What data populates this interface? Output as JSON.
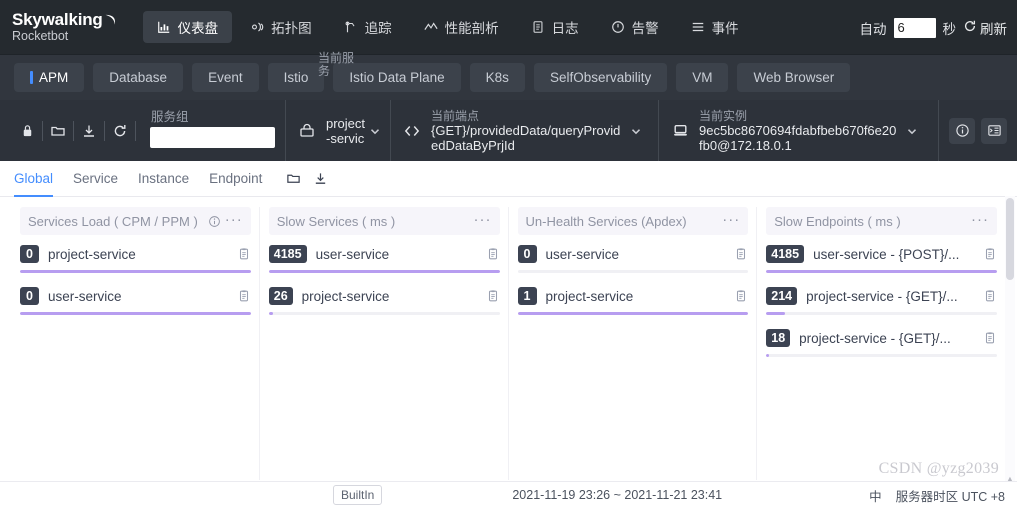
{
  "brand": {
    "name": "Skywalking",
    "sub": "Rocketbot"
  },
  "topnav": {
    "items": [
      {
        "label": "仪表盘",
        "icon": "dashboard-icon",
        "active": true
      },
      {
        "label": "拓扑图",
        "icon": "topology-icon",
        "active": false
      },
      {
        "label": "追踪",
        "icon": "trace-icon",
        "active": false
      },
      {
        "label": "性能剖析",
        "icon": "profile-icon",
        "active": false
      },
      {
        "label": "日志",
        "icon": "log-icon",
        "active": false
      },
      {
        "label": "告警",
        "icon": "alarm-icon",
        "active": false
      },
      {
        "label": "事件",
        "icon": "event-icon",
        "active": false
      }
    ],
    "auto_label": "自动",
    "auto_value": "6",
    "seconds_label": "秒",
    "refresh_label": "刷新"
  },
  "tabs": [
    {
      "label": "APM",
      "active": true
    },
    {
      "label": "Database",
      "active": false
    },
    {
      "label": "Event",
      "active": false
    },
    {
      "label": "Istio",
      "active": false
    },
    {
      "label": "Istio Data Plane",
      "active": false
    },
    {
      "label": "K8s",
      "active": false
    },
    {
      "label": "SelfObservability",
      "active": false
    },
    {
      "label": "VM",
      "active": false
    },
    {
      "label": "Web Browser",
      "active": false
    }
  ],
  "selector": {
    "icons": [
      "lock-icon",
      "folder-icon",
      "download-icon",
      "refresh-icon"
    ],
    "group_label": "服务组",
    "group_value": "",
    "service": {
      "label": "当前服务",
      "value": "project-servic"
    },
    "endpoint": {
      "label": "当前端点",
      "value": "{GET}/providedData/queryProvidedDataByPrjId"
    },
    "instance": {
      "label": "当前实例",
      "value": "9ec5bc8670694fdabfbeb670f6e20fb0@172.18.0.1"
    },
    "right_icons": [
      "info-icon",
      "list-panel-icon"
    ]
  },
  "subnav": {
    "items": [
      {
        "label": "Global",
        "active": true
      },
      {
        "label": "Service",
        "active": false
      },
      {
        "label": "Instance",
        "active": false
      },
      {
        "label": "Endpoint",
        "active": false
      }
    ],
    "icons": [
      "folder-icon",
      "download-icon"
    ]
  },
  "panels": [
    {
      "title": "Services Load ( CPM / PPM )",
      "has_info": true,
      "rows": [
        {
          "value": "0",
          "name": "project-service",
          "pct": 100
        },
        {
          "value": "0",
          "name": "user-service",
          "pct": 100
        }
      ]
    },
    {
      "title": "Slow Services ( ms )",
      "has_info": false,
      "rows": [
        {
          "value": "4185",
          "name": "user-service",
          "pct": 100
        },
        {
          "value": "26",
          "name": "project-service",
          "pct": 2
        }
      ]
    },
    {
      "title": "Un-Health Services (Apdex)",
      "has_info": false,
      "rows": [
        {
          "value": "0",
          "name": "user-service",
          "pct": 0
        },
        {
          "value": "1",
          "name": "project-service",
          "pct": 100
        }
      ]
    },
    {
      "title": "Slow Endpoints ( ms )",
      "has_info": false,
      "rows": [
        {
          "value": "4185",
          "name": "user-service - {POST}/...",
          "pct": 100
        },
        {
          "value": "214",
          "name": "project-service - {GET}/...",
          "pct": 8
        },
        {
          "value": "18",
          "name": "project-service - {GET}/...",
          "pct": 1
        }
      ]
    }
  ],
  "bottom": {
    "button_label": "BuiltIn",
    "time_range": "2021-11-19 23:26 ~ 2021-11-21 23:41",
    "lang": "中",
    "timezone": "服务器时区 UTC +8"
  },
  "watermark": "CSDN @yzg2039",
  "colors": {
    "accent": "#448dfe",
    "bar": "#b79df0",
    "badge": "#3c4352",
    "topnav_bg": "#252a2f",
    "tabrow_bg": "#31363e",
    "selbar_bg": "#2d323a"
  }
}
